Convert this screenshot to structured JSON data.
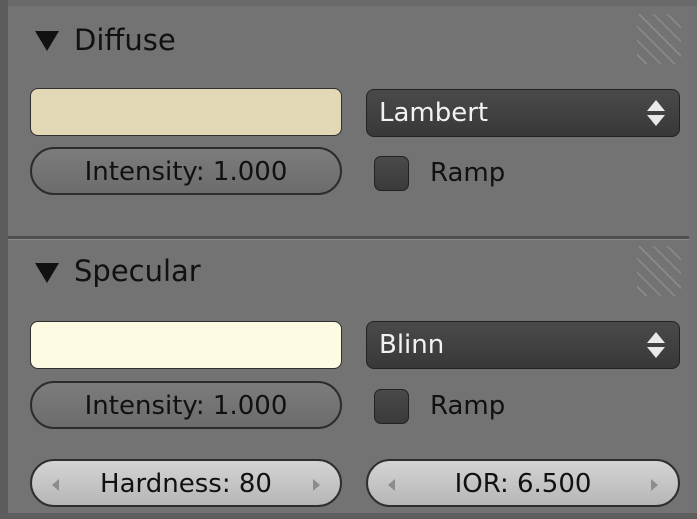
{
  "colors": {
    "diffuse_color": "#e2d8b6",
    "specular_color": "#fdfbe2",
    "panel_background": "#737373",
    "dropdown_background": "#404040"
  },
  "diffuse": {
    "title": "Diffuse",
    "shader": "Lambert",
    "intensity": "Intensity: 1.000",
    "ramp_label": "Ramp",
    "ramp_checked": false
  },
  "specular": {
    "title": "Specular",
    "shader": "Blinn",
    "intensity": "Intensity: 1.000",
    "ramp_label": "Ramp",
    "ramp_checked": false,
    "hardness": "Hardness: 80",
    "ior": "IOR: 6.500"
  },
  "icons": {
    "collapse": "triangle-down-icon",
    "dropdown": "up-down-arrows-icon",
    "slider_left": "arrow-left-icon",
    "slider_right": "arrow-right-icon",
    "grip": "drag-grip-icon"
  }
}
